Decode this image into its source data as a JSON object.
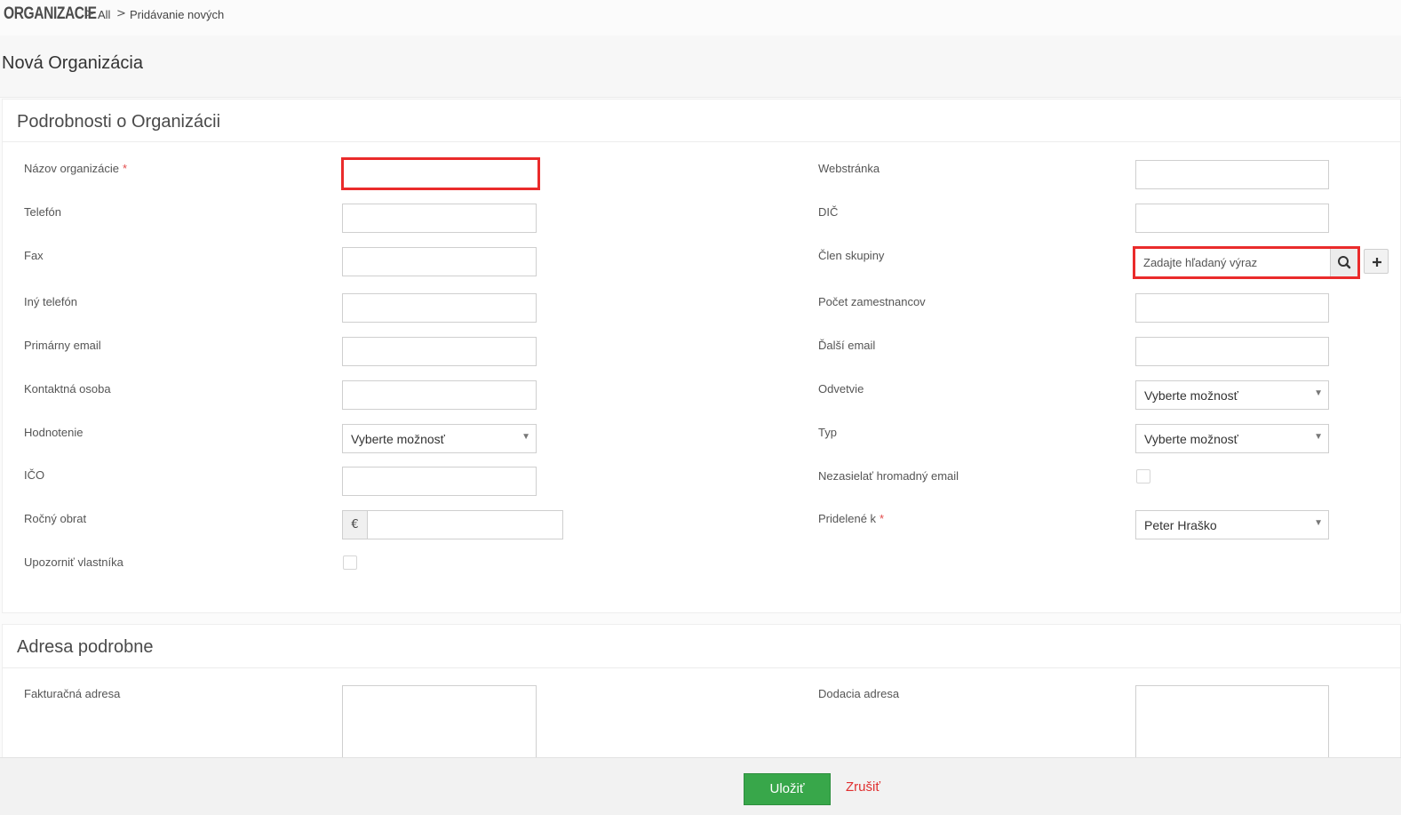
{
  "breadcrumb": {
    "module": "ORGANIZACIE",
    "sep": ">",
    "items": [
      "All",
      "Pridávanie nových"
    ]
  },
  "page_title": "Nová Organizácia",
  "details_block": {
    "title": "Podrobnosti o Organizácii",
    "required_mark": "*",
    "left": {
      "name_label": "Názov organizácie",
      "phone_label": "Telefón",
      "fax_label": "Fax",
      "other_phone_label": "Iný telefón",
      "primary_email_label": "Primárny email",
      "contact_label": "Kontaktná osoba",
      "rating_label": "Hodnotenie",
      "rating_value": "Vyberte možnosť",
      "ico_label": "IČO",
      "revenue_label": "Ročný obrat",
      "currency_symbol": "€",
      "notify_owner_label": "Upozorniť vlastníka"
    },
    "right": {
      "website_label": "Webstránka",
      "dic_label": "DIČ",
      "group_member_label": "Člen skupiny",
      "group_member_placeholder": "Zadajte hľadaný výraz",
      "employees_label": "Počet zamestnancov",
      "secondary_email_label": "Ďalší email",
      "industry_label": "Odvetvie",
      "industry_value": "Vyberte možnosť",
      "type_label": "Typ",
      "type_value": "Vyberte možnosť",
      "no_mass_email_label": "Nezasielať hromadný email",
      "assigned_label": "Pridelené k",
      "assigned_value": "Peter Hraško"
    }
  },
  "address_block": {
    "title": "Adresa podrobne",
    "billing_label": "Fakturačná adresa",
    "shipping_label": "Dodacia adresa"
  },
  "footer": {
    "save_label": "Uložiť",
    "cancel_label": "Zrušiť"
  },
  "icons": {
    "search": "search-icon",
    "plus": "plus-icon",
    "dropdown": "chevron-down-icon"
  },
  "colors": {
    "required": "#e34b4b",
    "highlight": "#ea2b2b",
    "save": "#38a74a",
    "cancel": "#e03030"
  }
}
